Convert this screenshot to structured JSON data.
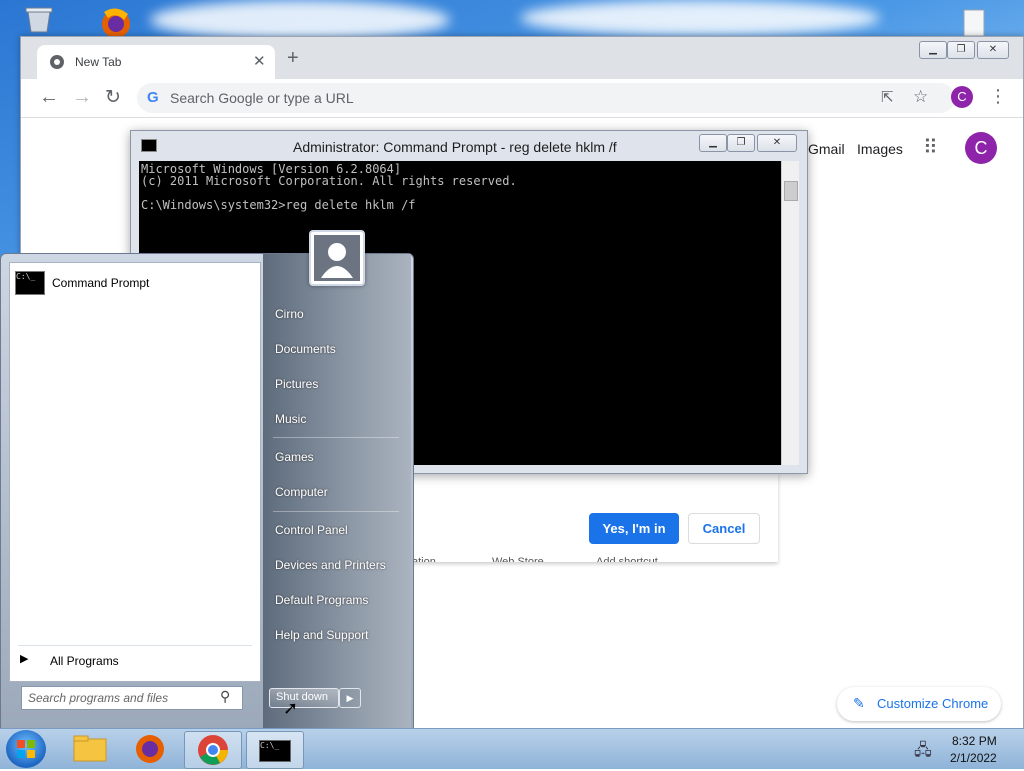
{
  "chrome": {
    "tab_title": "New Tab",
    "omnibox_placeholder": "Search Google or type a URL",
    "avatar_letter": "C",
    "links": [
      "Gmail",
      "Images"
    ],
    "customize_label": "Customize Chrome"
  },
  "dialog": {
    "yes_label": "Yes, I'm in",
    "cancel_label": "Cancel",
    "partial_texts": [
      "ation",
      "Web Store",
      "Add shortcut"
    ]
  },
  "cmd": {
    "title": "Administrator: Command Prompt - reg  delete hklm /f",
    "lines": [
      "Microsoft Windows [Version 6.2.8064]",
      "(c) 2011 Microsoft Corporation. All rights reserved.",
      "",
      "C:\\Windows\\system32>reg delete hklm /f"
    ]
  },
  "startmenu": {
    "pinned": [
      {
        "label": "Command Prompt",
        "icon": "cmd-icon"
      }
    ],
    "all_programs": "All Programs",
    "search_placeholder": "Search programs and files",
    "right_items": [
      "Cirno",
      "Documents",
      "Pictures",
      "Music",
      "Games",
      "Computer",
      "Control Panel",
      "Devices and Printers",
      "Default Programs",
      "Help and Support"
    ],
    "shutdown_label": "Shut down"
  },
  "taskbar": {
    "time": "8:32 PM",
    "date": "2/1/2022"
  },
  "colors": {
    "accent": "#1a73e8",
    "avatar": "#8e24aa"
  }
}
